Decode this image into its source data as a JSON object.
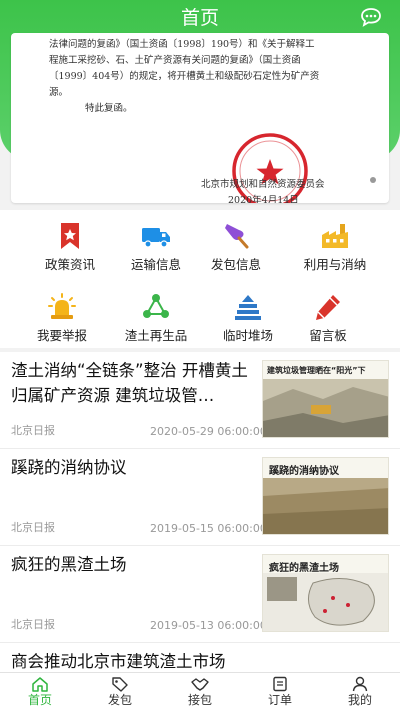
{
  "header": {
    "title": "首页",
    "chat_icon": "message-dots-icon"
  },
  "banner": {
    "doc_lines": [
      "法律问题的复函》（国土资函〔1998〕190号）和《关于解释工",
      "程施工采挖砂、石、土矿产资源有关问题的复函》（国土资函",
      "〔1999〕404号）的规定，将开槽黄土和级配砂石定性为矿产资",
      "源。"
    ],
    "doc_closing": "特此复函。",
    "signature_org": "北京市规划和自然资源委员会",
    "signature_date": "2020年4月14日",
    "seal_text": "北京市规划和自然资源委员会",
    "seal_color": "#d7262e"
  },
  "menu": [
    {
      "label": "政策资讯",
      "icon": "bookmark-icon"
    },
    {
      "label": "运输信息",
      "icon": "truck-icon"
    },
    {
      "label": "发包信息",
      "icon": "shovel-icon"
    },
    {
      "label": "利用与消纳",
      "icon": "factory-icon"
    },
    {
      "label": "我要举报",
      "icon": "alarm-light-icon"
    },
    {
      "label": "渣土再生品",
      "icon": "recycle-icon"
    },
    {
      "label": "临时堆场",
      "icon": "layers-icon"
    },
    {
      "label": "留言板",
      "icon": "pencil-icon"
    }
  ],
  "news": [
    {
      "title": "渣土消纳“全链条”整治  开槽黄土归属矿产资源  建筑垃圾管…",
      "source": "北京日报",
      "date": "2020-05-29 06:00:00",
      "thumb_caption": "建筑垃圾管理晒在“阳光”下"
    },
    {
      "title": "蹊跷的消纳协议",
      "source": "北京日报",
      "date": "2019-05-15 06:00:00",
      "thumb_caption": "蹊跷的消纳协议"
    },
    {
      "title": "疯狂的黑渣土场",
      "source": "北京日报",
      "date": "2019-05-13 06:00:00",
      "thumb_caption": "疯狂的黑渣土场"
    },
    {
      "title": "商会推动北京市建筑渣土市场"
    }
  ],
  "tabs": [
    {
      "label": "首页",
      "icon": "home-icon",
      "active": true
    },
    {
      "label": "发包",
      "icon": "tag-icon",
      "active": false
    },
    {
      "label": "接包",
      "icon": "handshake-icon",
      "active": false
    },
    {
      "label": "订单",
      "icon": "order-list-icon",
      "active": false
    },
    {
      "label": "我的",
      "icon": "user-icon",
      "active": false
    }
  ],
  "colors": {
    "brand_green": "#3dc34a",
    "active_tab": "#2fb53e",
    "icon_blue": "#1e8fe6",
    "icon_red": "#d9342b"
  }
}
